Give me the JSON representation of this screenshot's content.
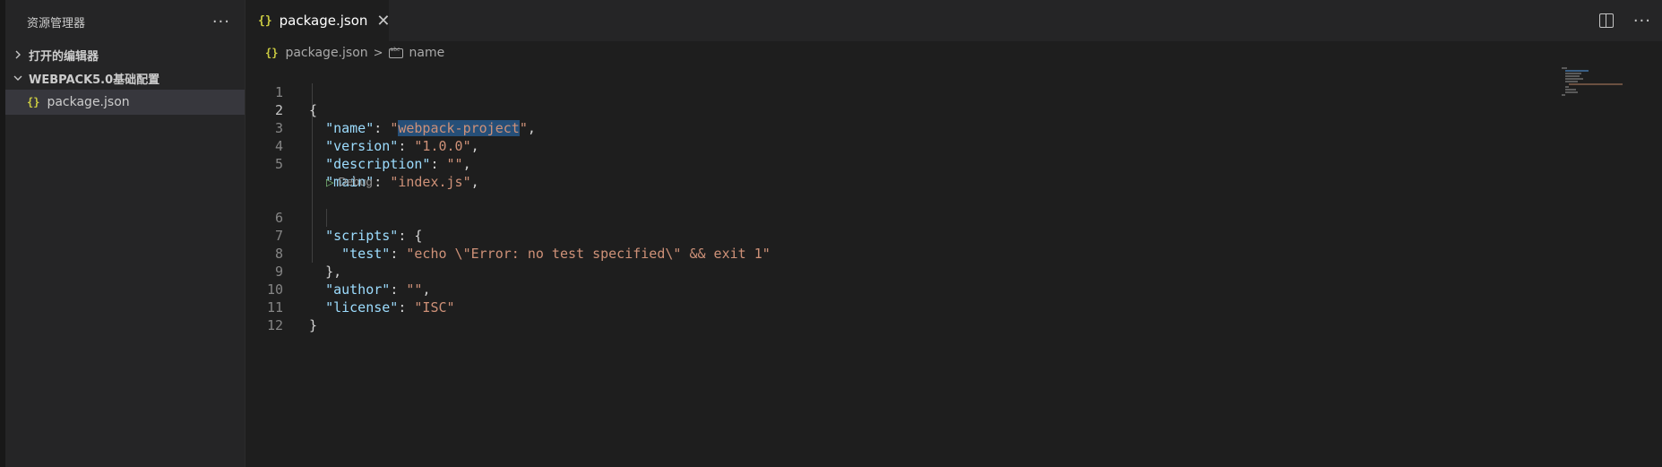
{
  "sidebar": {
    "title": "资源管理器",
    "more_icon": "ellipsis-icon",
    "open_editors_label": "打开的编辑器",
    "workspace_label": "WEBPACK5.0基础配置",
    "files": [
      {
        "icon": "{}",
        "name": "package.json"
      }
    ]
  },
  "tabs": [
    {
      "icon": "{}",
      "label": "package.json",
      "close": "✕"
    }
  ],
  "breadcrumb": {
    "icon": "{}",
    "file": "package.json",
    "separator": ">",
    "symbol": "name"
  },
  "codelens": {
    "label": "Debug"
  },
  "editor": {
    "line_numbers": [
      "1",
      "2",
      "3",
      "4",
      "5",
      "6",
      "7",
      "8",
      "9",
      "10",
      "11",
      "12"
    ],
    "active_line": "2",
    "code": {
      "l1": "{",
      "l2": [
        "\"name\"",
        ": ",
        "\"",
        "webpack-project",
        "\"",
        ","
      ],
      "l3": [
        "\"version\"",
        ": ",
        "\"1.0.0\"",
        ","
      ],
      "l4": [
        "\"description\"",
        ": ",
        "\"\"",
        ","
      ],
      "l5": [
        "\"main\"",
        ": ",
        "\"index.js\"",
        ","
      ],
      "l6": [
        "\"scripts\"",
        ": {"
      ],
      "l7": [
        "\"test\"",
        ": ",
        "\"echo \\\"Error: no test specified\\\" && exit 1\""
      ],
      "l8": "},",
      "l9": [
        "\"author\"",
        ": ",
        "\"\"",
        ","
      ],
      "l10": [
        "\"license\"",
        ": ",
        "\"ISC\""
      ],
      "l11": "}"
    }
  },
  "colors": {
    "key": "#9cdcfe",
    "string": "#ce9178",
    "selection": "#264f78",
    "json_icon": "#cbcb41"
  }
}
